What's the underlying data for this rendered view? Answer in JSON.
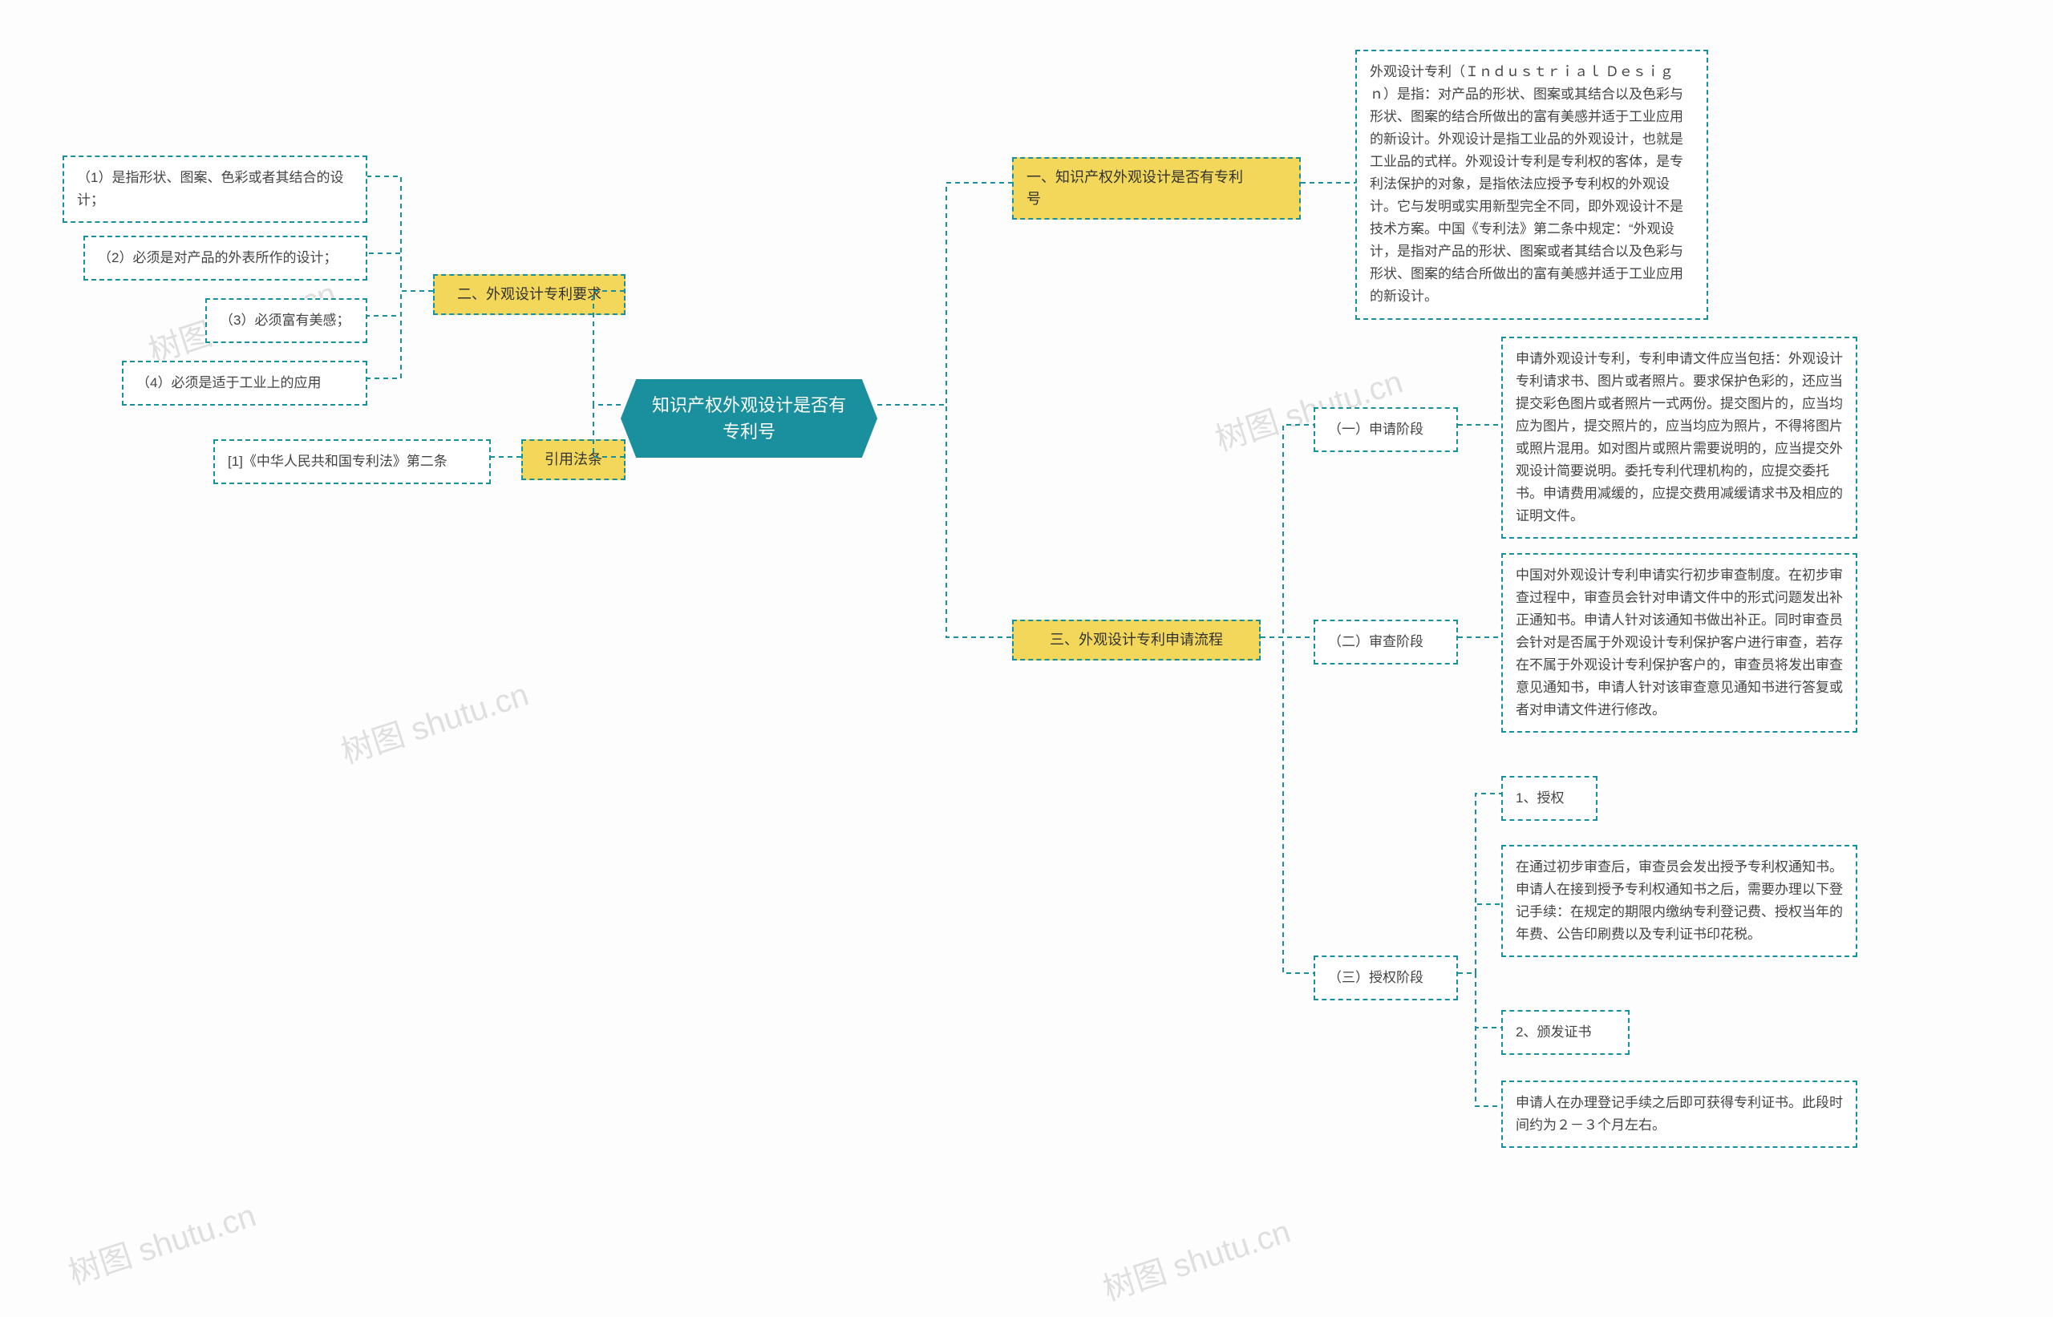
{
  "root": {
    "line1": "知识产权外观设计是否有",
    "line2": "专利号"
  },
  "left": {
    "section2": {
      "title": "二、外观设计专利要求",
      "items": [
        "（1）是指形状、图案、色彩或者其结合的设计；",
        "（2）必须是对产品的外表所作的设计；",
        "（3）必须富有美感；",
        "（4）必须是适于工业上的应用"
      ]
    },
    "citation": {
      "title": "引用法条",
      "items": [
        "[1]《中华人民共和国专利法》第二条"
      ]
    }
  },
  "right": {
    "section1": {
      "title_line1": "一、知识产权外观设计是否有专利",
      "title_line2": "号",
      "body": "外观设计专利（Ｉｎｄｕｓｔｒｉａｌ Ｄｅｓｉｇｎ）是指：对产品的形状、图案或其结合以及色彩与形状、图案的结合所做出的富有美感并适于工业应用的新设计。外观设计是指工业品的外观设计，也就是工业品的式样。外观设计专利是专利权的客体，是专利法保护的对象，是指依法应授予专利权的外观设计。它与发明或实用新型完全不同，即外观设计不是技术方案。中国《专利法》第二条中规定：“外观设计，是指对产品的形状、图案或者其结合以及色彩与形状、图案的结合所做出的富有美感并适于工业应用的新设计。"
    },
    "section3": {
      "title": "三、外观设计专利申请流程",
      "stages": [
        {
          "name": "（一）申请阶段",
          "body": "申请外观设计专利，专利申请文件应当包括：外观设计专利请求书、图片或者照片。要求保护色彩的，还应当提交彩色图片或者照片一式两份。提交图片的，应当均应为图片，提交照片的，应当均应为照片，不得将图片或照片混用。如对图片或照片需要说明的，应当提交外观设计简要说明。委托专利代理机构的，应提交委托书。申请费用减缓的，应提交费用减缓请求书及相应的证明文件。"
        },
        {
          "name": "（二）审查阶段",
          "body": "中国对外观设计专利申请实行初步审查制度。在初步审查过程中，审查员会针对申请文件中的形式问题发出补正通知书。申请人针对该通知书做出补正。同时审查员会针对是否属于外观设计专利保护客户进行审查，若存在不属于外观设计专利保护客户的，审查员将发出审查意见通知书，申请人针对该审查意见通知书进行答复或者对申请文件进行修改。"
        },
        {
          "name": "（三）授权阶段",
          "sub": [
            {
              "label": "1、授权"
            },
            {
              "body": "在通过初步审查后，审查员会发出授予专利权通知书。申请人在接到授予专利权通知书之后，需要办理以下登记手续：在规定的期限内缴纳专利登记费、授权当年的年费、公告印刷费以及专利证书印花税。"
            },
            {
              "label": "2、颁发证书"
            },
            {
              "body": "申请人在办理登记手续之后即可获得专利证书。此段时间约为２－３个月左右。"
            }
          ]
        }
      ]
    }
  },
  "watermark": "树图 shutu.cn"
}
